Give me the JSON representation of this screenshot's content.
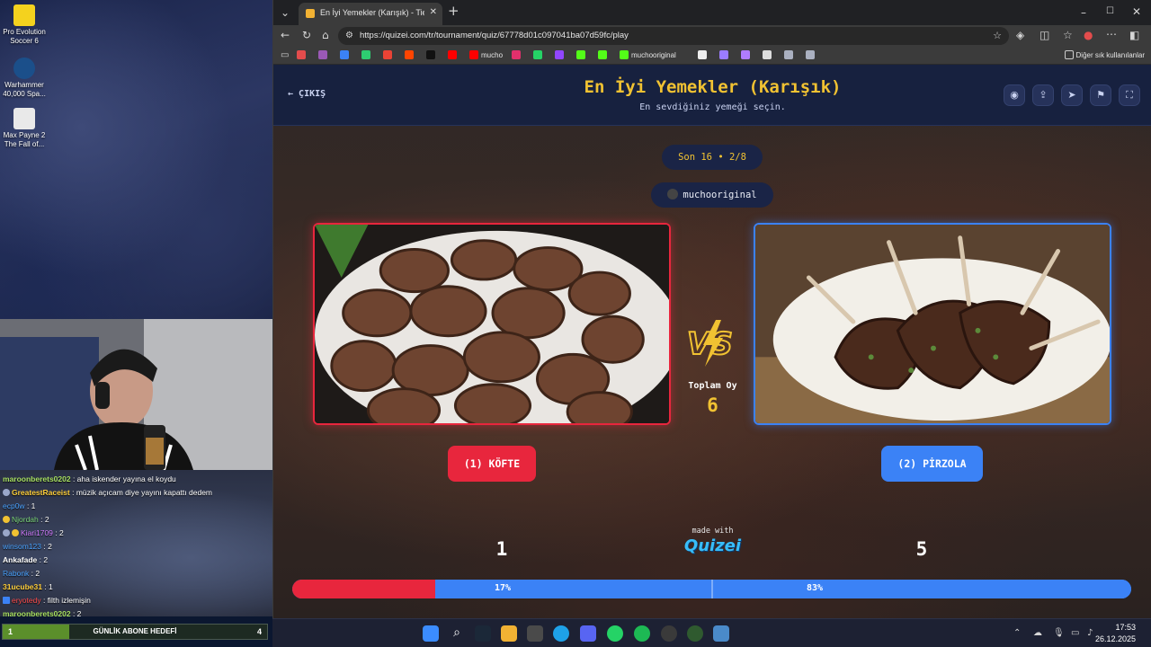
{
  "desktop": {
    "icons": [
      {
        "label_1": "Pro Evolution",
        "label_2": "Soccer 6",
        "icon": "pes-icon",
        "color": "#f4d21e"
      },
      {
        "label_1": "Warhammer",
        "label_2": "40,000 Spa...",
        "icon": "warhammer-icon",
        "color": "#1b4f8a"
      },
      {
        "label_1": "Max Payne 2",
        "label_2": "The Fall of...",
        "icon": "maxpayne-icon",
        "color": "#e9e9e9"
      }
    ]
  },
  "chat": {
    "lines": [
      {
        "user": "maroonberets0202",
        "text": " : aha iskender yayına el koydu",
        "color": "#a8e063"
      },
      {
        "user": "GreatestRaceist",
        "text": " : müzik açıcam diye yayını kapattı dedem",
        "color": "#ffcf3a"
      },
      {
        "user": "ecp0w",
        "text": " : 1",
        "color": "#4aa3ff"
      },
      {
        "user": "Njordah",
        "text": " : 2",
        "color": "#7cd67a"
      },
      {
        "user": "Kiari1709",
        "text": " : 2",
        "color": "#d27cff"
      },
      {
        "user": "winsom123",
        "text": " : 2",
        "color": "#4aa3ff"
      },
      {
        "user": "Ankafade",
        "text": " : 2",
        "color": "#ffffff"
      },
      {
        "user": "Rabonk",
        "text": " : 2",
        "color": "#4aa3ff"
      },
      {
        "user": "31ucube31",
        "text": " : 1",
        "color": "#ffcf3a"
      },
      {
        "user": "eryotedy",
        "text": " : filth izlemişin",
        "color": "#ff4d4d"
      },
      {
        "user": "maroonberets0202",
        "text": " : 2",
        "color": "#a8e063"
      }
    ]
  },
  "subgoal": {
    "label": "GÜNLİK ABONE HEDEFİ",
    "current": "1",
    "target": "4",
    "progress": 0.25
  },
  "browser": {
    "tab_title": "En İyi Yemekler (Karışık) - Tier List, Ş",
    "url": "https://quizei.com/tr/tournament/quiz/67778d01c097041ba07d59fc/play",
    "bookmarks": [
      {
        "label": "",
        "color": "#e34c4c"
      },
      {
        "label": "",
        "color": "#9b59b6"
      },
      {
        "label": "",
        "color": "#3b82f6"
      },
      {
        "label": "",
        "color": "#2ecc71"
      },
      {
        "label": "",
        "color": "#ea4335"
      },
      {
        "label": "",
        "color": "#ff4500"
      },
      {
        "label": "",
        "color": "#111111"
      },
      {
        "label": "",
        "color": "#ff0000"
      },
      {
        "label": "mucho",
        "color": "#ff0000"
      },
      {
        "label": "",
        "color": "#e1306c"
      },
      {
        "label": "",
        "color": "#25d366"
      },
      {
        "label": "",
        "color": "#9146ff"
      },
      {
        "label": "",
        "color": "#53fc18"
      },
      {
        "label": "",
        "color": "#53fc18"
      },
      {
        "label": "muchooriginal",
        "color": "#53fc18"
      },
      {
        "label": "",
        "color": "#eeeeee"
      },
      {
        "label": "",
        "color": "#9b7cff"
      },
      {
        "label": "",
        "color": "#b07cff"
      },
      {
        "label": "",
        "color": "#dddddd"
      },
      {
        "label": "",
        "color": "#aab0c0"
      },
      {
        "label": "",
        "color": "#aab0c0"
      }
    ],
    "other_bookmarks": "Diğer sık kullanılanlar"
  },
  "page": {
    "exit_label": "ÇIKIŞ",
    "title": "En İyi Yemekler (Karışık)",
    "subtitle": "En sevdiğiniz yemeği seçin.",
    "round": "Son 16 • 2/8",
    "creator": "muchooriginal",
    "left_choice": {
      "label": "(1) KÖFTE",
      "votes": "1",
      "percent": "17%",
      "fraction": 0.17,
      "color": "#e8263d"
    },
    "right_choice": {
      "label": "(2) PİRZOLA",
      "votes": "5",
      "percent": "83%",
      "fraction": 0.83,
      "color": "#3b82f6"
    },
    "total_label": "Toplam Oy",
    "total_value": "6",
    "made_with": "made with",
    "brand": "Quizei",
    "accent": "#f1c232"
  },
  "taskbar": {
    "time": "17:53",
    "date": "26.12.2025"
  }
}
